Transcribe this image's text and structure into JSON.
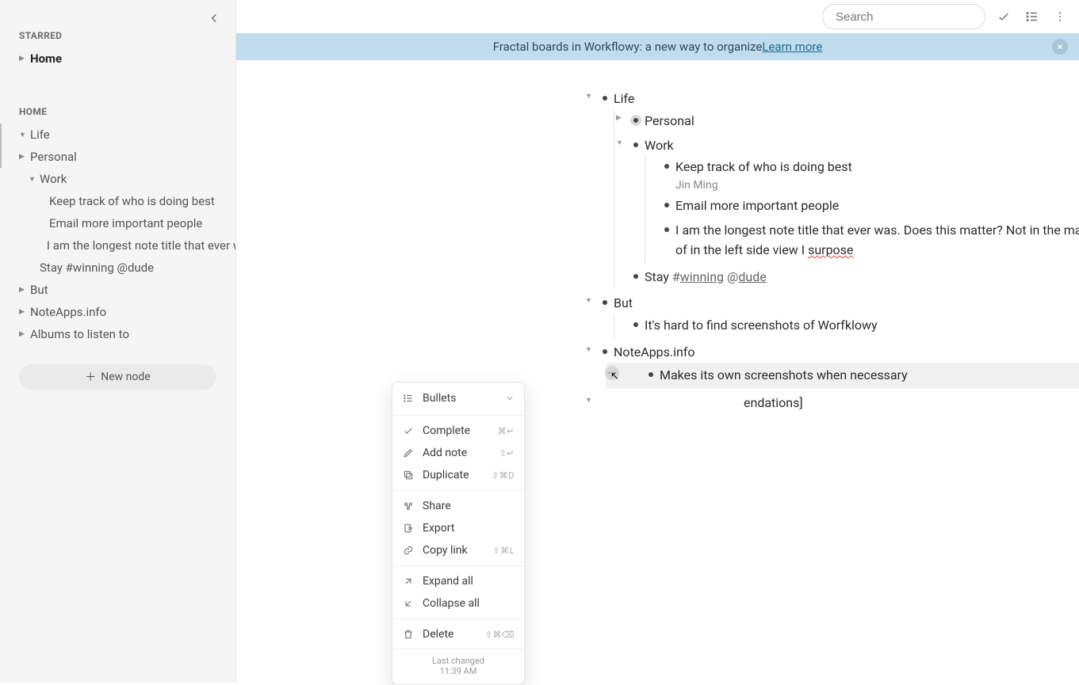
{
  "header": {
    "search_placeholder": "Search"
  },
  "banner": {
    "text": "Fractal boards in Workflowy: a new way to organize ",
    "link": "Learn more"
  },
  "sidebar": {
    "starred_title": "STARRED",
    "starred": [
      {
        "label": "Home"
      }
    ],
    "home_title": "HOME",
    "tree": {
      "life": "Life",
      "personal": "Personal",
      "work": "Work",
      "work_children": [
        "Keep track of who is doing best",
        "Email more important people",
        "I am the longest note title that ever was. Does this matter?"
      ],
      "stay": "Stay #winning @dude",
      "but": "But",
      "noteapps": "NoteApps.info",
      "albums": "Albums to listen to"
    },
    "new_node": "New node"
  },
  "outline": {
    "life": "Life",
    "personal": "Personal",
    "work": "Work",
    "work_items": {
      "keep": "Keep track of who is doing best",
      "keep_note": "Jin Ming",
      "email": "Email more important people",
      "longest_pre": "I am the longest note title that ever was. Does this matter? Not in the main view, but kind of in the left side view I ",
      "longest_misspell": "surpose"
    },
    "stay_pre": "Stay ",
    "stay_hash_prefix": "#",
    "stay_hash": "winning",
    "stay_at_prefix": " @",
    "stay_at": "dude",
    "but": "But",
    "but_child": "It's hard to find screenshots of Worfklowy",
    "noteapps": "NoteApps.info",
    "noteapps_child": "Makes its own screenshots when necessary",
    "hidden_frag": "endations]"
  },
  "ctx": {
    "bullets": "Bullets",
    "items": [
      {
        "icon": "check",
        "label": "Complete",
        "shortcut": "⌘↵"
      },
      {
        "icon": "pencil",
        "label": "Add note",
        "shortcut": "⇧↵"
      },
      {
        "icon": "dup",
        "label": "Duplicate",
        "shortcut": "⇧⌘D"
      }
    ],
    "group2": [
      {
        "icon": "share",
        "label": "Share",
        "shortcut": ""
      },
      {
        "icon": "export",
        "label": "Export",
        "shortcut": ""
      },
      {
        "icon": "link",
        "label": "Copy link",
        "shortcut": "⇧⌘L"
      }
    ],
    "group3": [
      {
        "icon": "expand",
        "label": "Expand all",
        "shortcut": ""
      },
      {
        "icon": "collapse",
        "label": "Collapse all",
        "shortcut": ""
      }
    ],
    "delete": {
      "label": "Delete",
      "shortcut": "⇧⌘⌫"
    },
    "footer_title": "Last changed",
    "footer_time": "11:39 AM"
  }
}
